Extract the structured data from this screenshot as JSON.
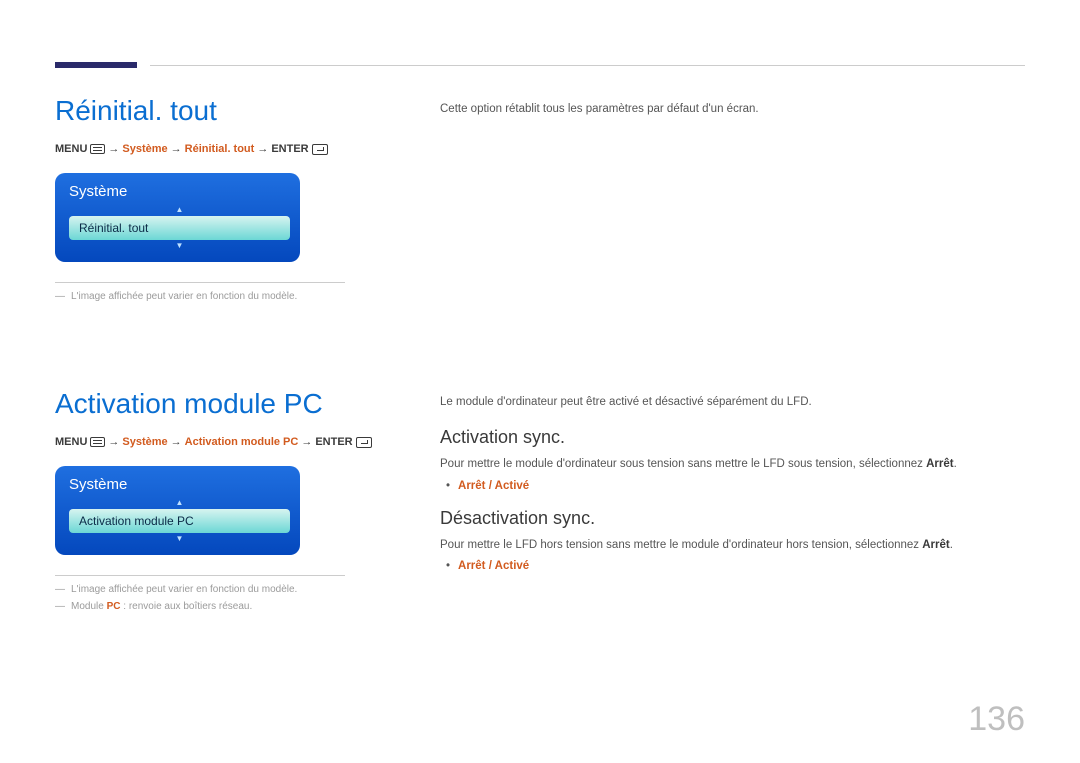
{
  "page_number": "136",
  "section1": {
    "title": "Réinitial. tout",
    "breadcrumb": {
      "menu": "MENU",
      "systeme": "Système",
      "item": "Réinitial. tout",
      "enter": "ENTER"
    },
    "osd": {
      "title": "Système",
      "row": "Réinitial. tout"
    },
    "footnote1": "L'image affichée peut varier en fonction du modèle.",
    "right": {
      "desc": "Cette option rétablit tous les paramètres par défaut d'un écran."
    }
  },
  "section2": {
    "title": "Activation module PC",
    "breadcrumb": {
      "menu": "MENU",
      "systeme": "Système",
      "item": "Activation module PC",
      "enter": "ENTER"
    },
    "osd": {
      "title": "Système",
      "row": "Activation module PC"
    },
    "footnote1": "L'image affichée peut varier en fonction du modèle.",
    "footnote2_pre": "Module",
    "footnote2_pc": "PC",
    "footnote2_post": ": renvoie aux boîtiers réseau.",
    "right": {
      "intro": "Le module d'ordinateur peut être activé et désactivé séparément du LFD.",
      "h2a": "Activation sync.",
      "p_a_pre": "Pour mettre le module d'ordinateur sous tension sans mettre le LFD sous tension, sélectionnez ",
      "p_a_bold": "Arrêt",
      "opts": "Arrêt / Activé",
      "h2b": "Désactivation sync.",
      "p_b_pre": "Pour mettre le LFD hors tension sans mettre le module d'ordinateur hors tension, sélectionnez ",
      "p_b_bold": "Arrêt"
    }
  }
}
